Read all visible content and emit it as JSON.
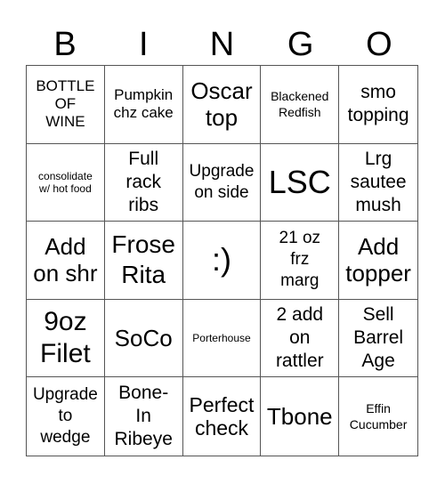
{
  "header": {
    "letters": [
      "B",
      "I",
      "N",
      "G",
      "O"
    ]
  },
  "cells": [
    {
      "text": "BOTTLE\nOF\nWINE",
      "size": "f16"
    },
    {
      "text": "Pumpkin\nchz cake",
      "size": "f16"
    },
    {
      "text": "Oscar\ntop",
      "size": "f25"
    },
    {
      "text": "Blackened\nRedfish",
      "size": "f14"
    },
    {
      "text": "smo\ntopping",
      "size": "f20"
    },
    {
      "text": "consolidate\nw/ hot food",
      "size": "f12"
    },
    {
      "text": "Full\nrack\nribs",
      "size": "f20"
    },
    {
      "text": "Upgrade\non side",
      "size": "f18"
    },
    {
      "text": "LSC",
      "size": "f34"
    },
    {
      "text": "Lrg\nsautee\nmush",
      "size": "f20"
    },
    {
      "text": "Add\non shr",
      "size": "f25"
    },
    {
      "text": "Frose\nRita",
      "size": "f28"
    },
    {
      "text": ":)",
      "size": "f34"
    },
    {
      "text": "21 oz\nfrz\nmarg",
      "size": "f18"
    },
    {
      "text": "Add\ntopper",
      "size": "f25"
    },
    {
      "text": "9oz\nFilet",
      "size": "f30"
    },
    {
      "text": "SoCo",
      "size": "f25"
    },
    {
      "text": "Porterhouse",
      "size": "f12"
    },
    {
      "text": "2 add\non\nrattler",
      "size": "f20"
    },
    {
      "text": "Sell\nBarrel\nAge",
      "size": "f20"
    },
    {
      "text": "Upgrade\nto\nwedge",
      "size": "f18"
    },
    {
      "text": "Bone-\nIn\nRibeye",
      "size": "f20"
    },
    {
      "text": "Perfect\ncheck",
      "size": "f22"
    },
    {
      "text": "Tbone",
      "size": "f25"
    },
    {
      "text": "Effin\nCucumber",
      "size": "f14"
    }
  ]
}
